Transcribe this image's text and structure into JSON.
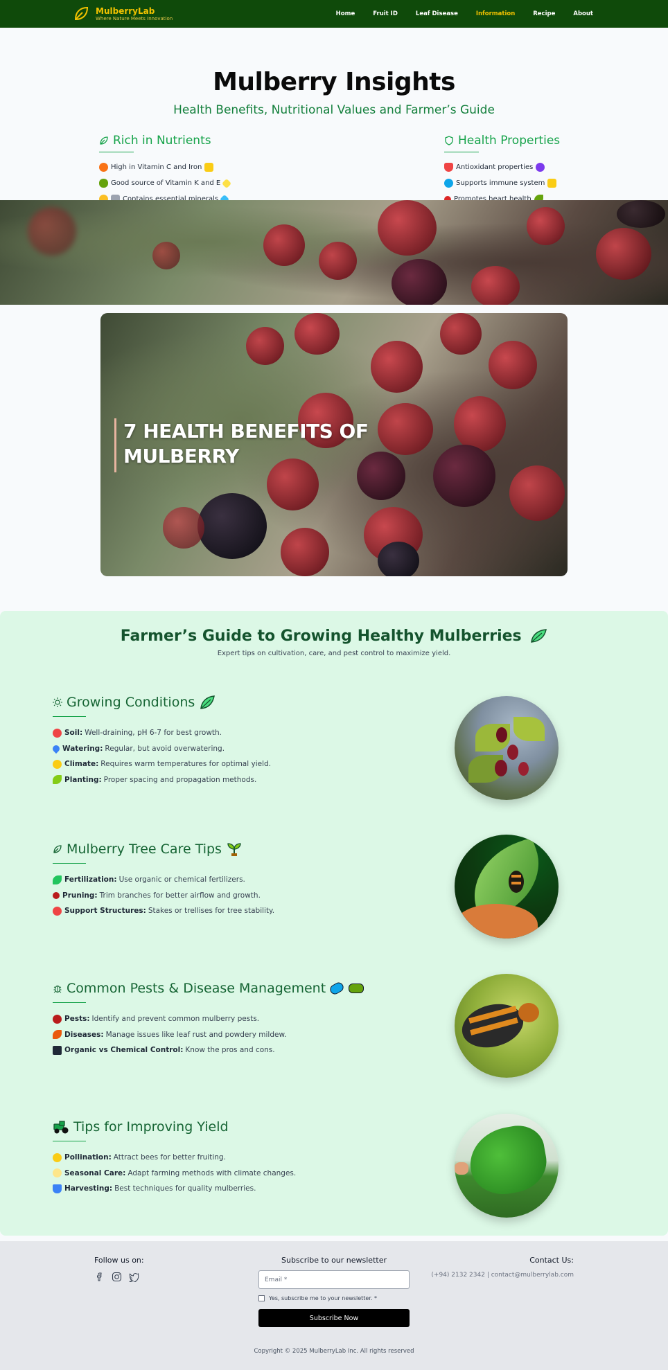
{
  "brand": {
    "name": "MulberryLab",
    "tagline": "Where Nature Meets Innovation"
  },
  "nav": {
    "items": [
      "Home",
      "Fruit ID",
      "Leaf Disease",
      "Information",
      "Recipe",
      "About"
    ],
    "active": "Information"
  },
  "hero": {
    "title": "Mulberry Insights",
    "subtitle": "Health Benefits, Nutritional Values and Farmer’s Guide",
    "nutrients": {
      "heading": "Rich in Nutrients",
      "items": [
        "High in Vitamin C and Iron",
        "Good source of Vitamin K and E",
        "Contains essential minerals"
      ]
    },
    "health": {
      "heading": "Health Properties",
      "items": [
        "Antioxidant properties",
        "Supports immune system",
        "Promotes heart health"
      ]
    }
  },
  "feature_card": {
    "title": "7 HEALTH BENEFITS OF MULBERRY"
  },
  "guide": {
    "title": "Farmer’s Guide to Growing Healthy Mulberries",
    "subtitle": "Expert tips on cultivation, care, and pest control to maximize yield.",
    "sections": [
      {
        "heading": "Growing Conditions",
        "items": [
          {
            "label": "Soil:",
            "text": "Well-draining, pH 6-7 for best growth."
          },
          {
            "label": "Watering:",
            "text": "Regular, but avoid overwatering."
          },
          {
            "label": "Climate:",
            "text": "Requires warm temperatures for optimal yield."
          },
          {
            "label": "Planting:",
            "text": "Proper spacing and propagation methods."
          }
        ]
      },
      {
        "heading": "Mulberry Tree Care Tips",
        "items": [
          {
            "label": "Fertilization:",
            "text": "Use organic or chemical fertilizers."
          },
          {
            "label": "Pruning:",
            "text": "Trim branches for better airflow and growth."
          },
          {
            "label": "Support Structures:",
            "text": "Stakes or trellises for tree stability."
          }
        ]
      },
      {
        "heading": "Common Pests & Disease Management",
        "items": [
          {
            "label": "Pests:",
            "text": "Identify and prevent common mulberry pests."
          },
          {
            "label": "Diseases:",
            "text": "Manage issues like leaf rust and powdery mildew."
          },
          {
            "label": "Organic vs Chemical Control:",
            "text": "Know the pros and cons."
          }
        ]
      },
      {
        "heading": "Tips for Improving Yield",
        "items": [
          {
            "label": "Pollination:",
            "text": "Attract bees for better fruiting."
          },
          {
            "label": "Seasonal Care:",
            "text": "Adapt farming methods with climate changes."
          },
          {
            "label": "Harvesting:",
            "text": "Best techniques for quality mulberries."
          }
        ]
      }
    ]
  },
  "footer": {
    "follow": "Follow us on:",
    "newsletter_title": "Subscribe to our newsletter",
    "email_placeholder": "Email *",
    "consent": "Yes, subscribe me to your newsletter. *",
    "subscribe_label": "Subscribe Now",
    "contact_title": "Contact Us:",
    "contact": "(+94) 2132 2342 | contact@mulberrylab.com",
    "copyright": "Copyright © 2025 MulberryLab Inc. All rights reserved"
  },
  "colors": {
    "nav_bg": "#0f4a0a",
    "accent_gold": "#f2c200",
    "green": "#16a34a",
    "guide_bg": "#dcf8e6",
    "footer_bg": "#e5e7eb"
  }
}
